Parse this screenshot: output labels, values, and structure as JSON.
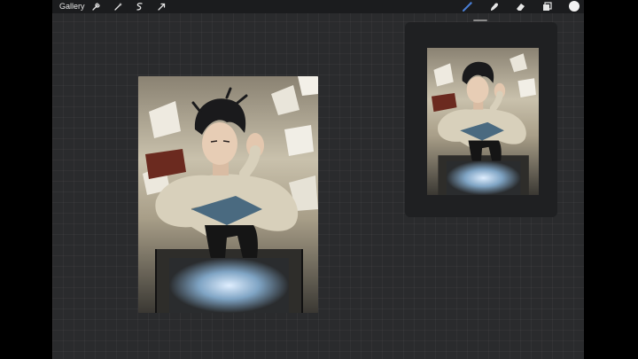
{
  "toolbar": {
    "gallery_label": "Gallery",
    "left_icons": [
      "wrench-icon",
      "magic-wand-icon",
      "selection-icon",
      "transform-arrow-icon"
    ],
    "right_icons": [
      "brush-icon",
      "smudge-icon",
      "eraser-icon",
      "layers-icon"
    ],
    "active_tool": "brush",
    "brush_color": "#4a7fd6",
    "current_color": "#f2f2f2"
  },
  "reference_panel": {
    "visible": true
  },
  "sidebar": {
    "controls": [
      "brush-size-slider",
      "modify-button",
      "opacity-slider",
      "undo-button",
      "redo-button"
    ]
  },
  "colors": {
    "canvas_bg": "#2a2b2d",
    "toolbar_bg": "#1b1c1e",
    "panel_bg": "#1f2022"
  }
}
